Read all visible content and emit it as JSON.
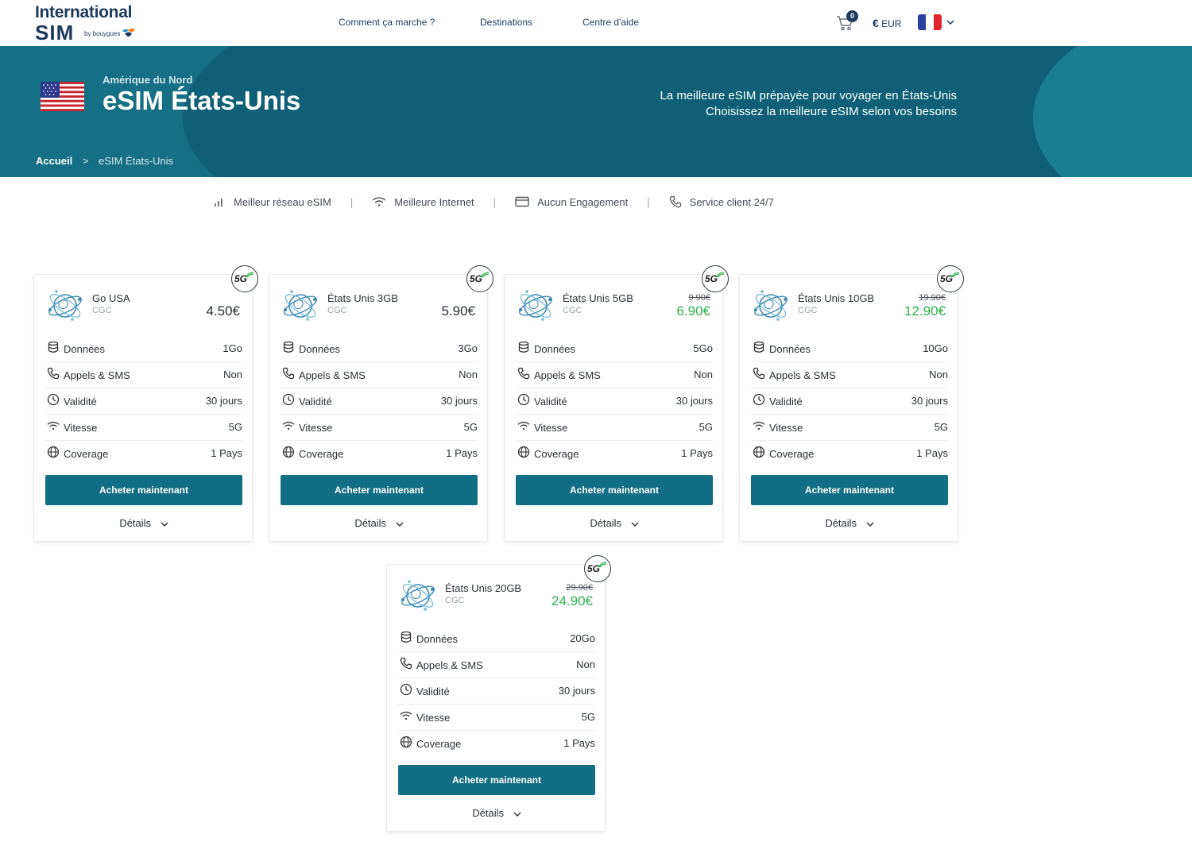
{
  "header": {
    "logo_line1": "International",
    "logo_line2": "SIM",
    "logo_by": "by bouygues",
    "nav": [
      "Comment ça marche ?",
      "Destinations",
      "Centre d'aide"
    ],
    "cart_count": "0",
    "currency_symbol": "€",
    "currency_code": "EUR"
  },
  "hero": {
    "region": "Amérique du Nord",
    "title": "eSIM États-Unis",
    "tagline1": "La meilleure eSIM prépayée pour voyager en États-Unis",
    "tagline2": "Choisissez la meilleure eSIM selon vos besoins",
    "breadcrumb_home": "Accueil",
    "breadcrumb_sep": ">",
    "breadcrumb_current": "eSIM États-Unis"
  },
  "features": {
    "items": [
      "Meilleur réseau eSIM",
      "Meilleure Internet",
      "Aucun Engagement",
      "Service client 24/7"
    ],
    "separator": "|"
  },
  "labels": {
    "data": "Données",
    "calls": "Appels & SMS",
    "validity": "Validité",
    "speed": "Vitesse",
    "coverage": "Coverage",
    "buy": "Acheter maintenant",
    "details": "Détails",
    "badge": "5G"
  },
  "plans": [
    {
      "name": "Go USA",
      "cgc": "CGC",
      "old_price": "",
      "price": "4.50€",
      "promo": false,
      "data": "1Go",
      "calls": "Non",
      "validity": "30 jours",
      "speed": "5G",
      "coverage": "1 Pays"
    },
    {
      "name": "États Unis 3GB",
      "cgc": "CGC",
      "old_price": "",
      "price": "5.90€",
      "promo": false,
      "data": "3Go",
      "calls": "Non",
      "validity": "30 jours",
      "speed": "5G",
      "coverage": "1 Pays"
    },
    {
      "name": "États Unis 5GB",
      "cgc": "CGC",
      "old_price": "9.90€",
      "price": "6.90€",
      "promo": true,
      "data": "5Go",
      "calls": "Non",
      "validity": "30 jours",
      "speed": "5G",
      "coverage": "1 Pays"
    },
    {
      "name": "États Unis 10GB",
      "cgc": "CGC",
      "old_price": "19.90€",
      "price": "12.90€",
      "promo": true,
      "data": "10Go",
      "calls": "Non",
      "validity": "30 jours",
      "speed": "5G",
      "coverage": "1 Pays"
    },
    {
      "name": "États Unis 20GB",
      "cgc": "CGC",
      "old_price": "29.90€",
      "price": "24.90€",
      "promo": true,
      "data": "20Go",
      "calls": "Non",
      "validity": "30 jours",
      "speed": "5G",
      "coverage": "1 Pays"
    }
  ],
  "colors": {
    "brand": "#126e84",
    "hero": "#156f85",
    "promo": "#2bb24c",
    "text": "#2a2f36"
  }
}
